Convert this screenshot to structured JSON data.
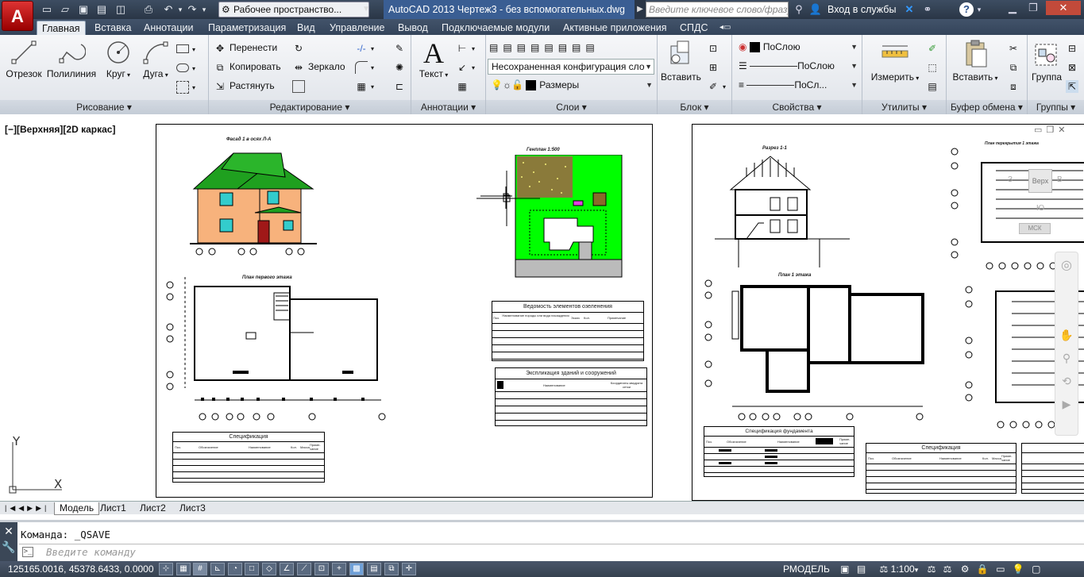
{
  "app": {
    "logo": "A",
    "workspace": "Рабочее пространство...",
    "title": "AutoCAD 2013    Чертеж3 - без вспомогательных.dwg",
    "search_placeholder": "Введите ключевое слово/фразу",
    "login": "Вход в службы",
    "help": "?"
  },
  "tabs": [
    "Главная",
    "Вставка",
    "Аннотации",
    "Параметризация",
    "Вид",
    "Управление",
    "Вывод",
    "Подключаемые модули",
    "Активные приложения",
    "СПДС"
  ],
  "panels": {
    "draw": {
      "title": "Рисование",
      "tools": [
        "Отрезок",
        "Полилиния",
        "Круг",
        "Дуга"
      ]
    },
    "modify": {
      "title": "Редактирование",
      "tools": [
        "Перенести",
        "Копировать",
        "Растянуть",
        "Зеркало"
      ]
    },
    "annotation": {
      "title": "Аннотации",
      "tools": [
        "Текст"
      ]
    },
    "layers": {
      "title": "Слои",
      "config": "Несохраненная конфигурация сло",
      "layer": "Размеры"
    },
    "block": {
      "title": "Блок",
      "tools": [
        "Вставить"
      ]
    },
    "properties": {
      "title": "Свойства",
      "color": "ПоСлою",
      "linetype": "ПоСлою",
      "lineweight": "ПоСл..."
    },
    "utilities": {
      "title": "Утилиты",
      "tools": [
        "Измерить"
      ]
    },
    "clipboard": {
      "title": "Буфер обмена",
      "tools": [
        "Вставить"
      ]
    },
    "groups": {
      "title": "Группы",
      "tools": [
        "Группа"
      ]
    }
  },
  "viewport": {
    "label": "[−][Верхняя][2D каркас]",
    "viewcube": {
      "top": "Верх",
      "west": "З",
      "east": "В",
      "south": "Ю",
      "wcs": "МСК"
    }
  },
  "sheet1": {
    "facade_title": "Фасад 1 в осях Л-А",
    "siteplan_title": "Генплан 1:500",
    "floorplan_title": "План первого этажа",
    "table1_title": "Ведомость элементов озеленения",
    "table1_headers": [
      "Поз.",
      "Наименование породы или вида насаждения",
      "Эскиз",
      "Кол.",
      "Примечание"
    ],
    "table2_title": "Экспликация зданий и сооружений",
    "table2_headers": [
      "Наименование",
      "Координаты квадрата сетки"
    ],
    "spec_title": "Спецификация",
    "spec_headers": [
      "Поз.",
      "Обозначение",
      "Наименование",
      "Кол.",
      "Масса",
      "Приме-чание"
    ]
  },
  "sheet2": {
    "section_title": "Разрез 1-1",
    "plan_title": "План 1 этажа",
    "roofplan_title": "План перекрытия 1 этажа",
    "spec_found_title": "Спецификация фундамента",
    "spec_title": "Спецификация",
    "spec_headers": [
      "Поз.",
      "Обозначение",
      "Наименование",
      "Кол.",
      "Масса",
      "Приме-чание"
    ]
  },
  "layout_tabs": [
    "Модель",
    "Лист1",
    "Лист2",
    "Лист3"
  ],
  "command": {
    "history": "Команда:  _QSAVE",
    "placeholder": "Введите команду"
  },
  "status": {
    "coords": "125165.0016, 45378.6433, 0.0000",
    "space": "РМОДЕЛЬ",
    "scale": "1:100"
  },
  "colors": {
    "roof": "#1fa01f",
    "wall": "#f7b27c",
    "site": "#00ff00",
    "ribbon_tab_active": "#e9edf2",
    "titlebar": "#2e3b4e"
  }
}
